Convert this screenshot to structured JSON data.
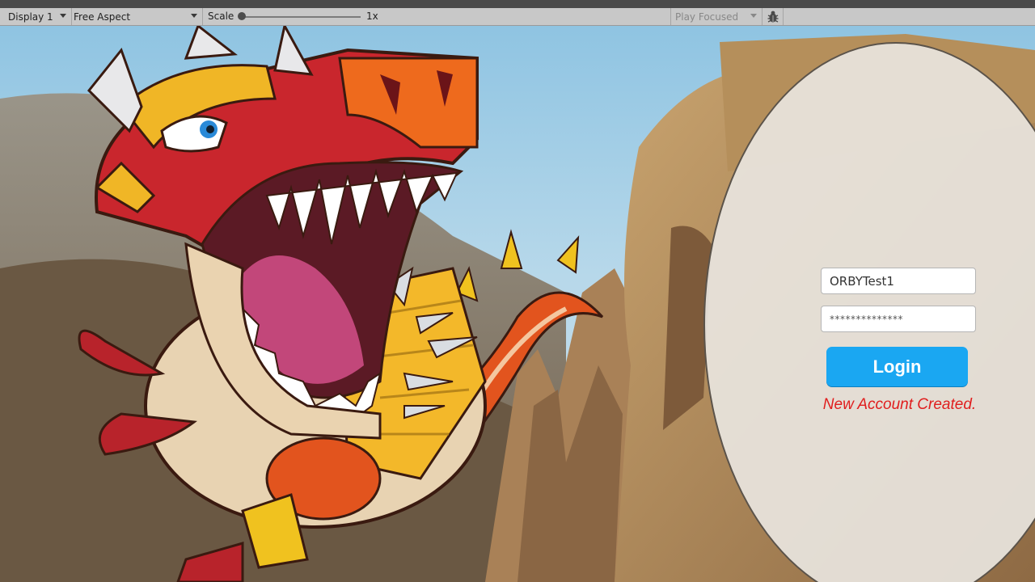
{
  "toolbar": {
    "display": "Display 1",
    "aspect": "Free Aspect",
    "scale_label": "Scale",
    "scale_value": "1x",
    "scale_level": 0.0,
    "play_mode": "Play Focused",
    "debug_icon": "bug-icon"
  },
  "login": {
    "username_value": "ORBYTest1",
    "password_value": "**************",
    "login_label": "Login",
    "status_message": "New Account Created."
  },
  "colors": {
    "login_button": "#1aa7f2",
    "status_text": "#e01e1e",
    "panel": "#e8e4de"
  }
}
